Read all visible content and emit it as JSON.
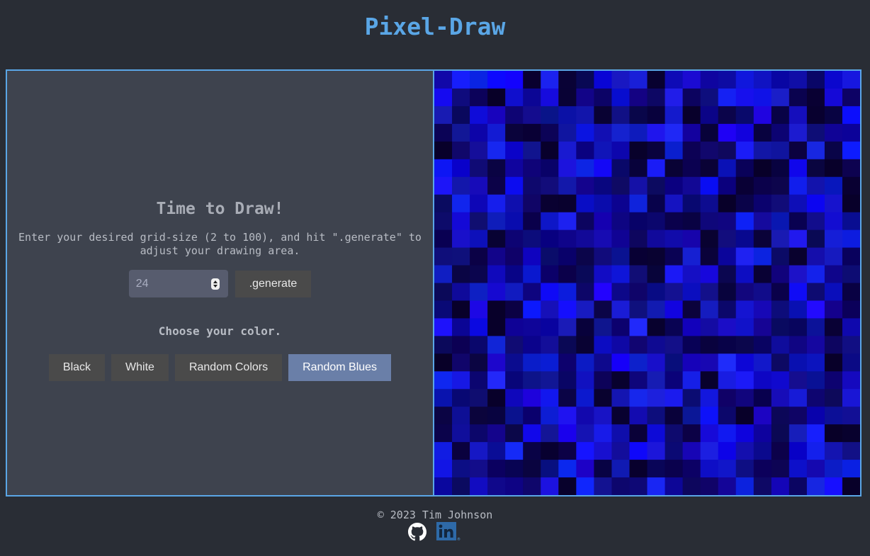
{
  "header": {
    "title": "Pixel-Draw"
  },
  "controls": {
    "heading": "Time to Draw!",
    "instructions": "Enter your desired grid-size (2 to 100), and hit \".generate\" to adjust your drawing area.",
    "grid_size_value": "24",
    "generate_label": ".generate",
    "choose_color_label": "Choose your color.",
    "color_buttons": [
      "Black",
      "White",
      "Random Colors",
      "Random Blues"
    ],
    "active_color": "Random Blues"
  },
  "canvas": {
    "grid_size": 24,
    "palette": "random-blues"
  },
  "footer": {
    "copyright": "© 2023 Tim Johnson",
    "icons": [
      "github-icon",
      "linkedin-icon"
    ]
  },
  "colors": {
    "accent": "#5aa6e6",
    "active_button": "#6a7fa8"
  }
}
